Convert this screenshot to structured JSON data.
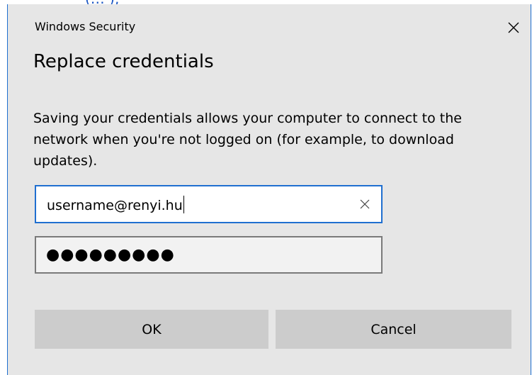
{
  "background_text": "(…             ),",
  "window": {
    "title": "Windows Security",
    "close_icon": "close-icon"
  },
  "dialog": {
    "heading": "Replace credentials",
    "description": "Saving your credentials allows your computer to connect to the network when you're not logged on (for example, to download updates)."
  },
  "fields": {
    "username": {
      "value": "username@renyi.hu",
      "clear_icon": "clear-icon"
    },
    "password": {
      "masked_value": "●●●●●●●●●"
    }
  },
  "buttons": {
    "ok": "OK",
    "cancel": "Cancel"
  },
  "colors": {
    "accent": "#1f6fd0",
    "dialog_background": "#e6e6e6",
    "button_background": "#cccccc",
    "password_border": "#7a7a7a"
  }
}
